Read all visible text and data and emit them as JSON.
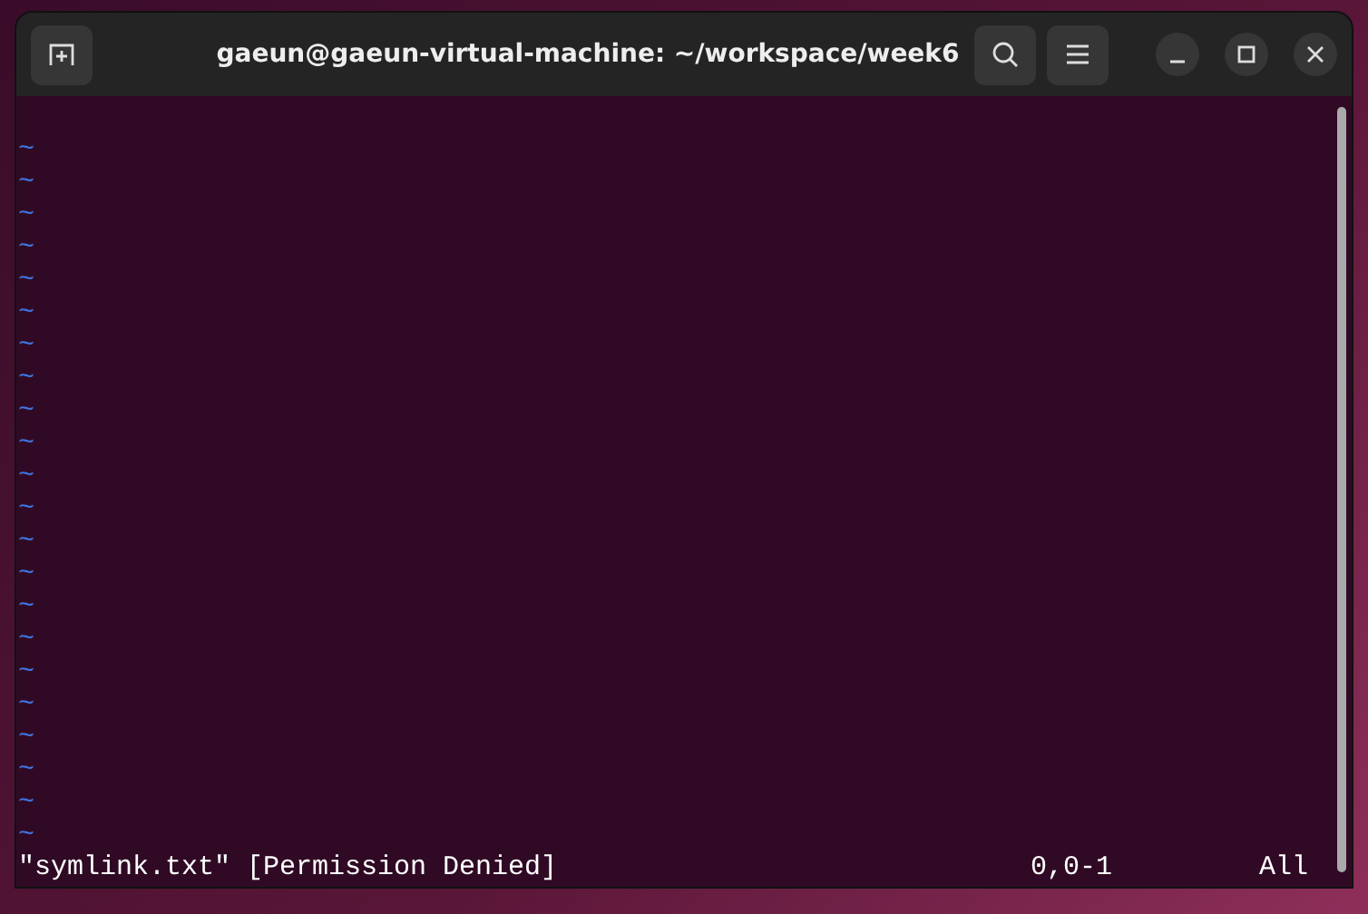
{
  "window": {
    "title": "gaeun@gaeun-virtual-machine: ~/workspace/week6"
  },
  "editor": {
    "empty_lines": [
      "~",
      "~",
      "~",
      "~",
      "~",
      "~",
      "~",
      "~",
      "~",
      "~",
      "~",
      "~",
      "~",
      "~",
      "~",
      "~",
      "~",
      "~",
      "~",
      "~",
      "~",
      "~"
    ]
  },
  "status_bar": {
    "message": "\"symlink.txt\" [Permission Denied]",
    "position": "0,0-1",
    "scroll": "All"
  }
}
